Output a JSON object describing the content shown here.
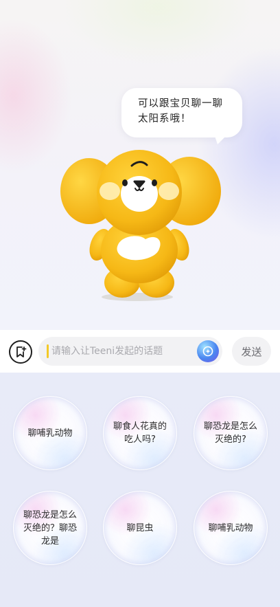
{
  "speech_bubble": {
    "line1": "可以跟宝贝聊一聊",
    "line2": "太阳系哦！"
  },
  "input_bar": {
    "placeholder": "请输入让Teeni发起的话题",
    "send_label": "发送"
  },
  "colors": {
    "mascot_yellow": "#f6b816",
    "accent_caret": "#f3c928",
    "ai_button": "#4a86f0"
  },
  "icons": {
    "bookmark": "bookmark-add-icon",
    "ai": "ai-sparkle-icon"
  },
  "suggestions": [
    {
      "label": "聊哺乳动物"
    },
    {
      "label": "聊食人花真的吃人吗?"
    },
    {
      "label": "聊恐龙是怎么灭绝的?"
    },
    {
      "label": "聊恐龙是怎么灭绝的？聊恐龙是"
    },
    {
      "label": "聊昆虫"
    },
    {
      "label": "聊哺乳动物"
    }
  ]
}
